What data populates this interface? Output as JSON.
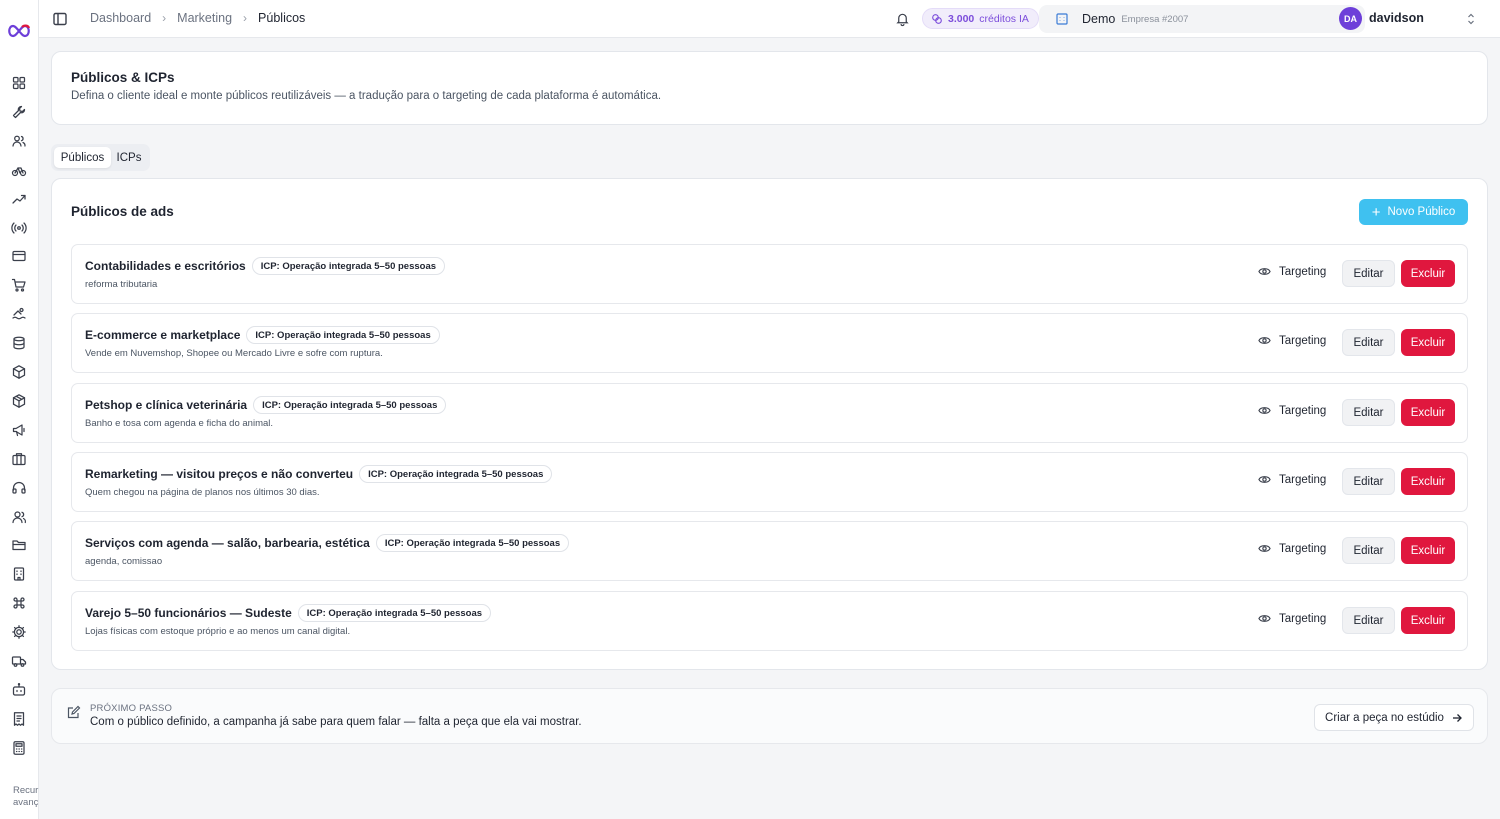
{
  "topbar": {
    "breadcrumb": [
      "Dashboard",
      "Marketing",
      "Públicos"
    ],
    "credits_amount": "3.000",
    "credits_label": "créditos IA",
    "company_name": "Demo",
    "company_sub": "Empresa #2007",
    "user_initials": "DA",
    "user_name": "davidson"
  },
  "header": {
    "title": "Públicos & ICPs",
    "subtitle": "Defina o cliente ideal e monte públicos reutilizáveis — a tradução para o targeting de cada plataforma é automática."
  },
  "tabs": [
    {
      "label": "Públicos",
      "active": true
    },
    {
      "label": "ICPs",
      "active": false
    }
  ],
  "list": {
    "title": "Públicos de ads",
    "new_button": "Novo Público",
    "targeting_label": "Targeting",
    "edit_label": "Editar",
    "delete_label": "Excluir",
    "rows": [
      {
        "name": "Contabilidades e escritórios",
        "icp": "ICP: Operação integrada 5–50 pessoas",
        "desc": "reforma tributaria"
      },
      {
        "name": "E-commerce e marketplace",
        "icp": "ICP: Operação integrada 5–50 pessoas",
        "desc": "Vende em Nuvemshop, Shopee ou Mercado Livre e sofre com ruptura."
      },
      {
        "name": "Petshop e clínica veterinária",
        "icp": "ICP: Operação integrada 5–50 pessoas",
        "desc": "Banho e tosa com agenda e ficha do animal."
      },
      {
        "name": "Remarketing — visitou preços e não converteu",
        "icp": "ICP: Operação integrada 5–50 pessoas",
        "desc": "Quem chegou na página de planos nos últimos 30 dias."
      },
      {
        "name": "Serviços com agenda — salão, barbearia, estética",
        "icp": "ICP: Operação integrada 5–50 pessoas",
        "desc": "agenda, comissao"
      },
      {
        "name": "Varejo 5–50 funcionários — Sudeste",
        "icp": "ICP: Operação integrada 5–50 pessoas",
        "desc": "Lojas físicas com estoque próprio e ao menos um canal digital."
      }
    ]
  },
  "next_step": {
    "label": "PRÓXIMO PASSO",
    "text": "Com o público definido, a campanha já sabe para quem falar — falta a peça que ela vai mostrar.",
    "button": "Criar a peça no estúdio"
  },
  "sidebar": {
    "footer_line1": "Recur",
    "footer_line2": "avanç",
    "icons": [
      "grid-icon",
      "wrench-icon",
      "users-icon",
      "bike-icon",
      "trending-up-icon",
      "broadcast-icon",
      "credit-card-icon",
      "cart-icon",
      "swimmer-icon",
      "database-icon",
      "box-icon",
      "package-icon",
      "megaphone-icon",
      "briefcase-icon",
      "headset-icon",
      "user-group-icon",
      "folder-icon",
      "building-icon",
      "command-icon",
      "settings-icon",
      "truck-icon",
      "bot-icon",
      "receipt-icon",
      "calculator-icon"
    ]
  },
  "colors": {
    "accent": "#3fc1f0",
    "danger": "#e0173e",
    "credits": "#7c4ddb",
    "avatar": "#6d3fd9"
  }
}
